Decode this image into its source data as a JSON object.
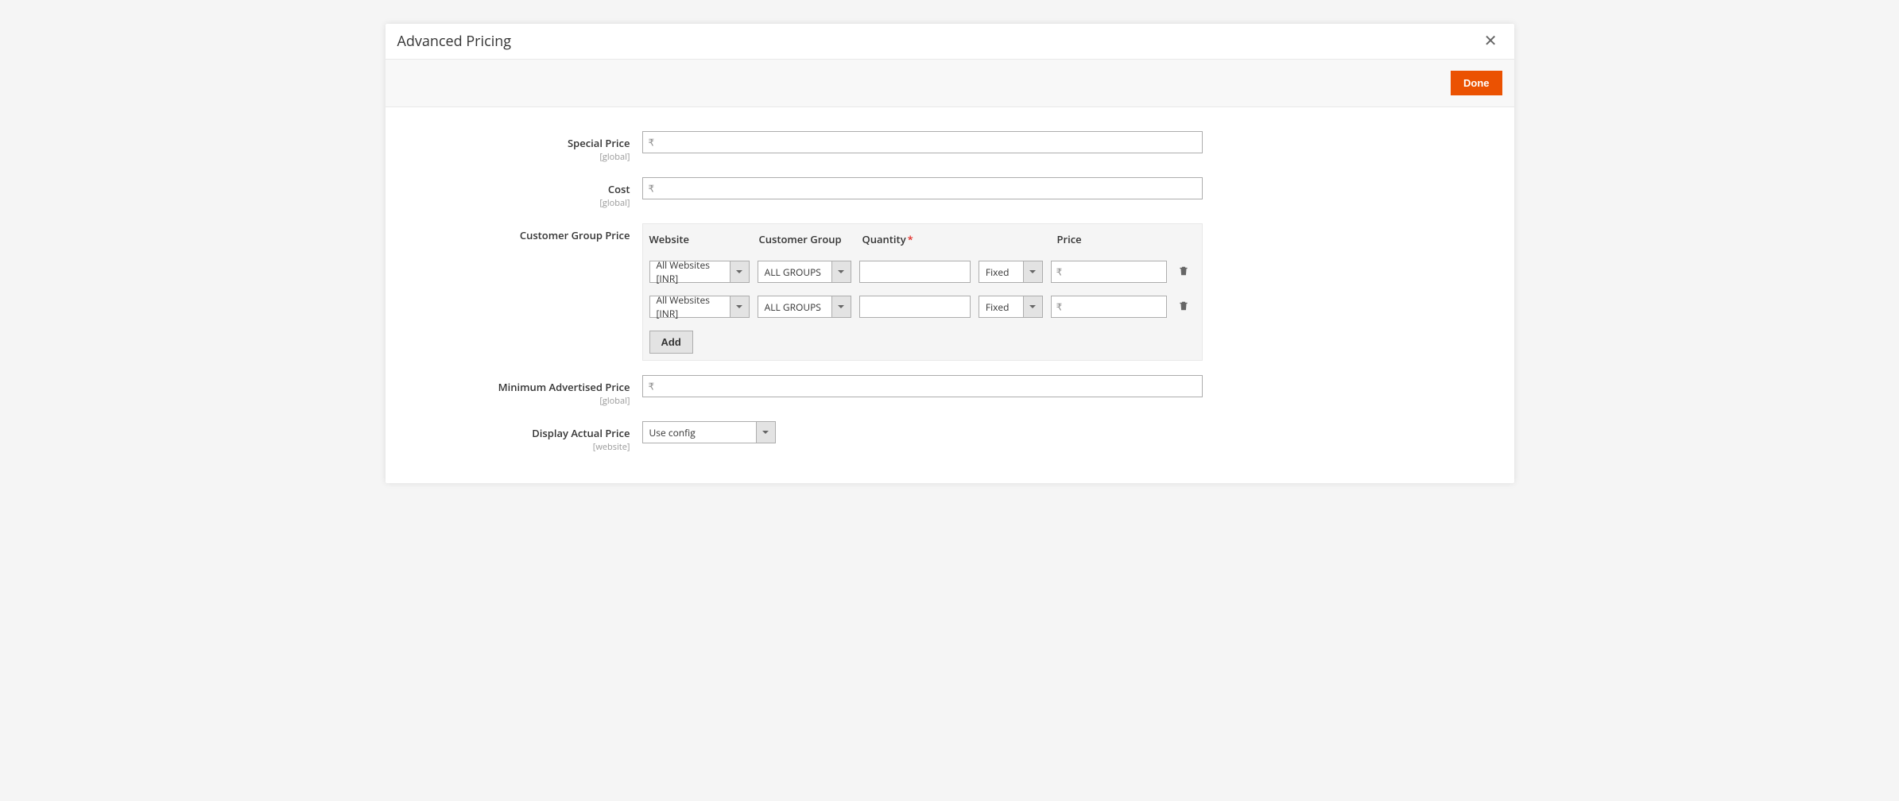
{
  "modal": {
    "title": "Advanced Pricing",
    "done_label": "Done"
  },
  "fields": {
    "special_price": {
      "label": "Special Price",
      "scope": "[global]",
      "currency": "₹",
      "value": ""
    },
    "cost": {
      "label": "Cost",
      "scope": "[global]",
      "currency": "₹",
      "value": ""
    },
    "tier_price": {
      "label": "Customer Group Price",
      "headers": {
        "website": "Website",
        "group": "Customer Group",
        "quantity": "Quantity",
        "price": "Price"
      },
      "rows": [
        {
          "website": "All Websites [INR]",
          "group": "ALL GROUPS",
          "quantity": "",
          "price_type": "Fixed",
          "currency": "₹",
          "price": ""
        },
        {
          "website": "All Websites [INR]",
          "group": "ALL GROUPS",
          "quantity": "",
          "price_type": "Fixed",
          "currency": "₹",
          "price": ""
        }
      ],
      "add_label": "Add"
    },
    "map": {
      "label": "Minimum Advertised Price",
      "scope": "[global]",
      "currency": "₹",
      "value": ""
    },
    "display_actual": {
      "label": "Display Actual Price",
      "scope": "[website]",
      "value": "Use config"
    }
  }
}
